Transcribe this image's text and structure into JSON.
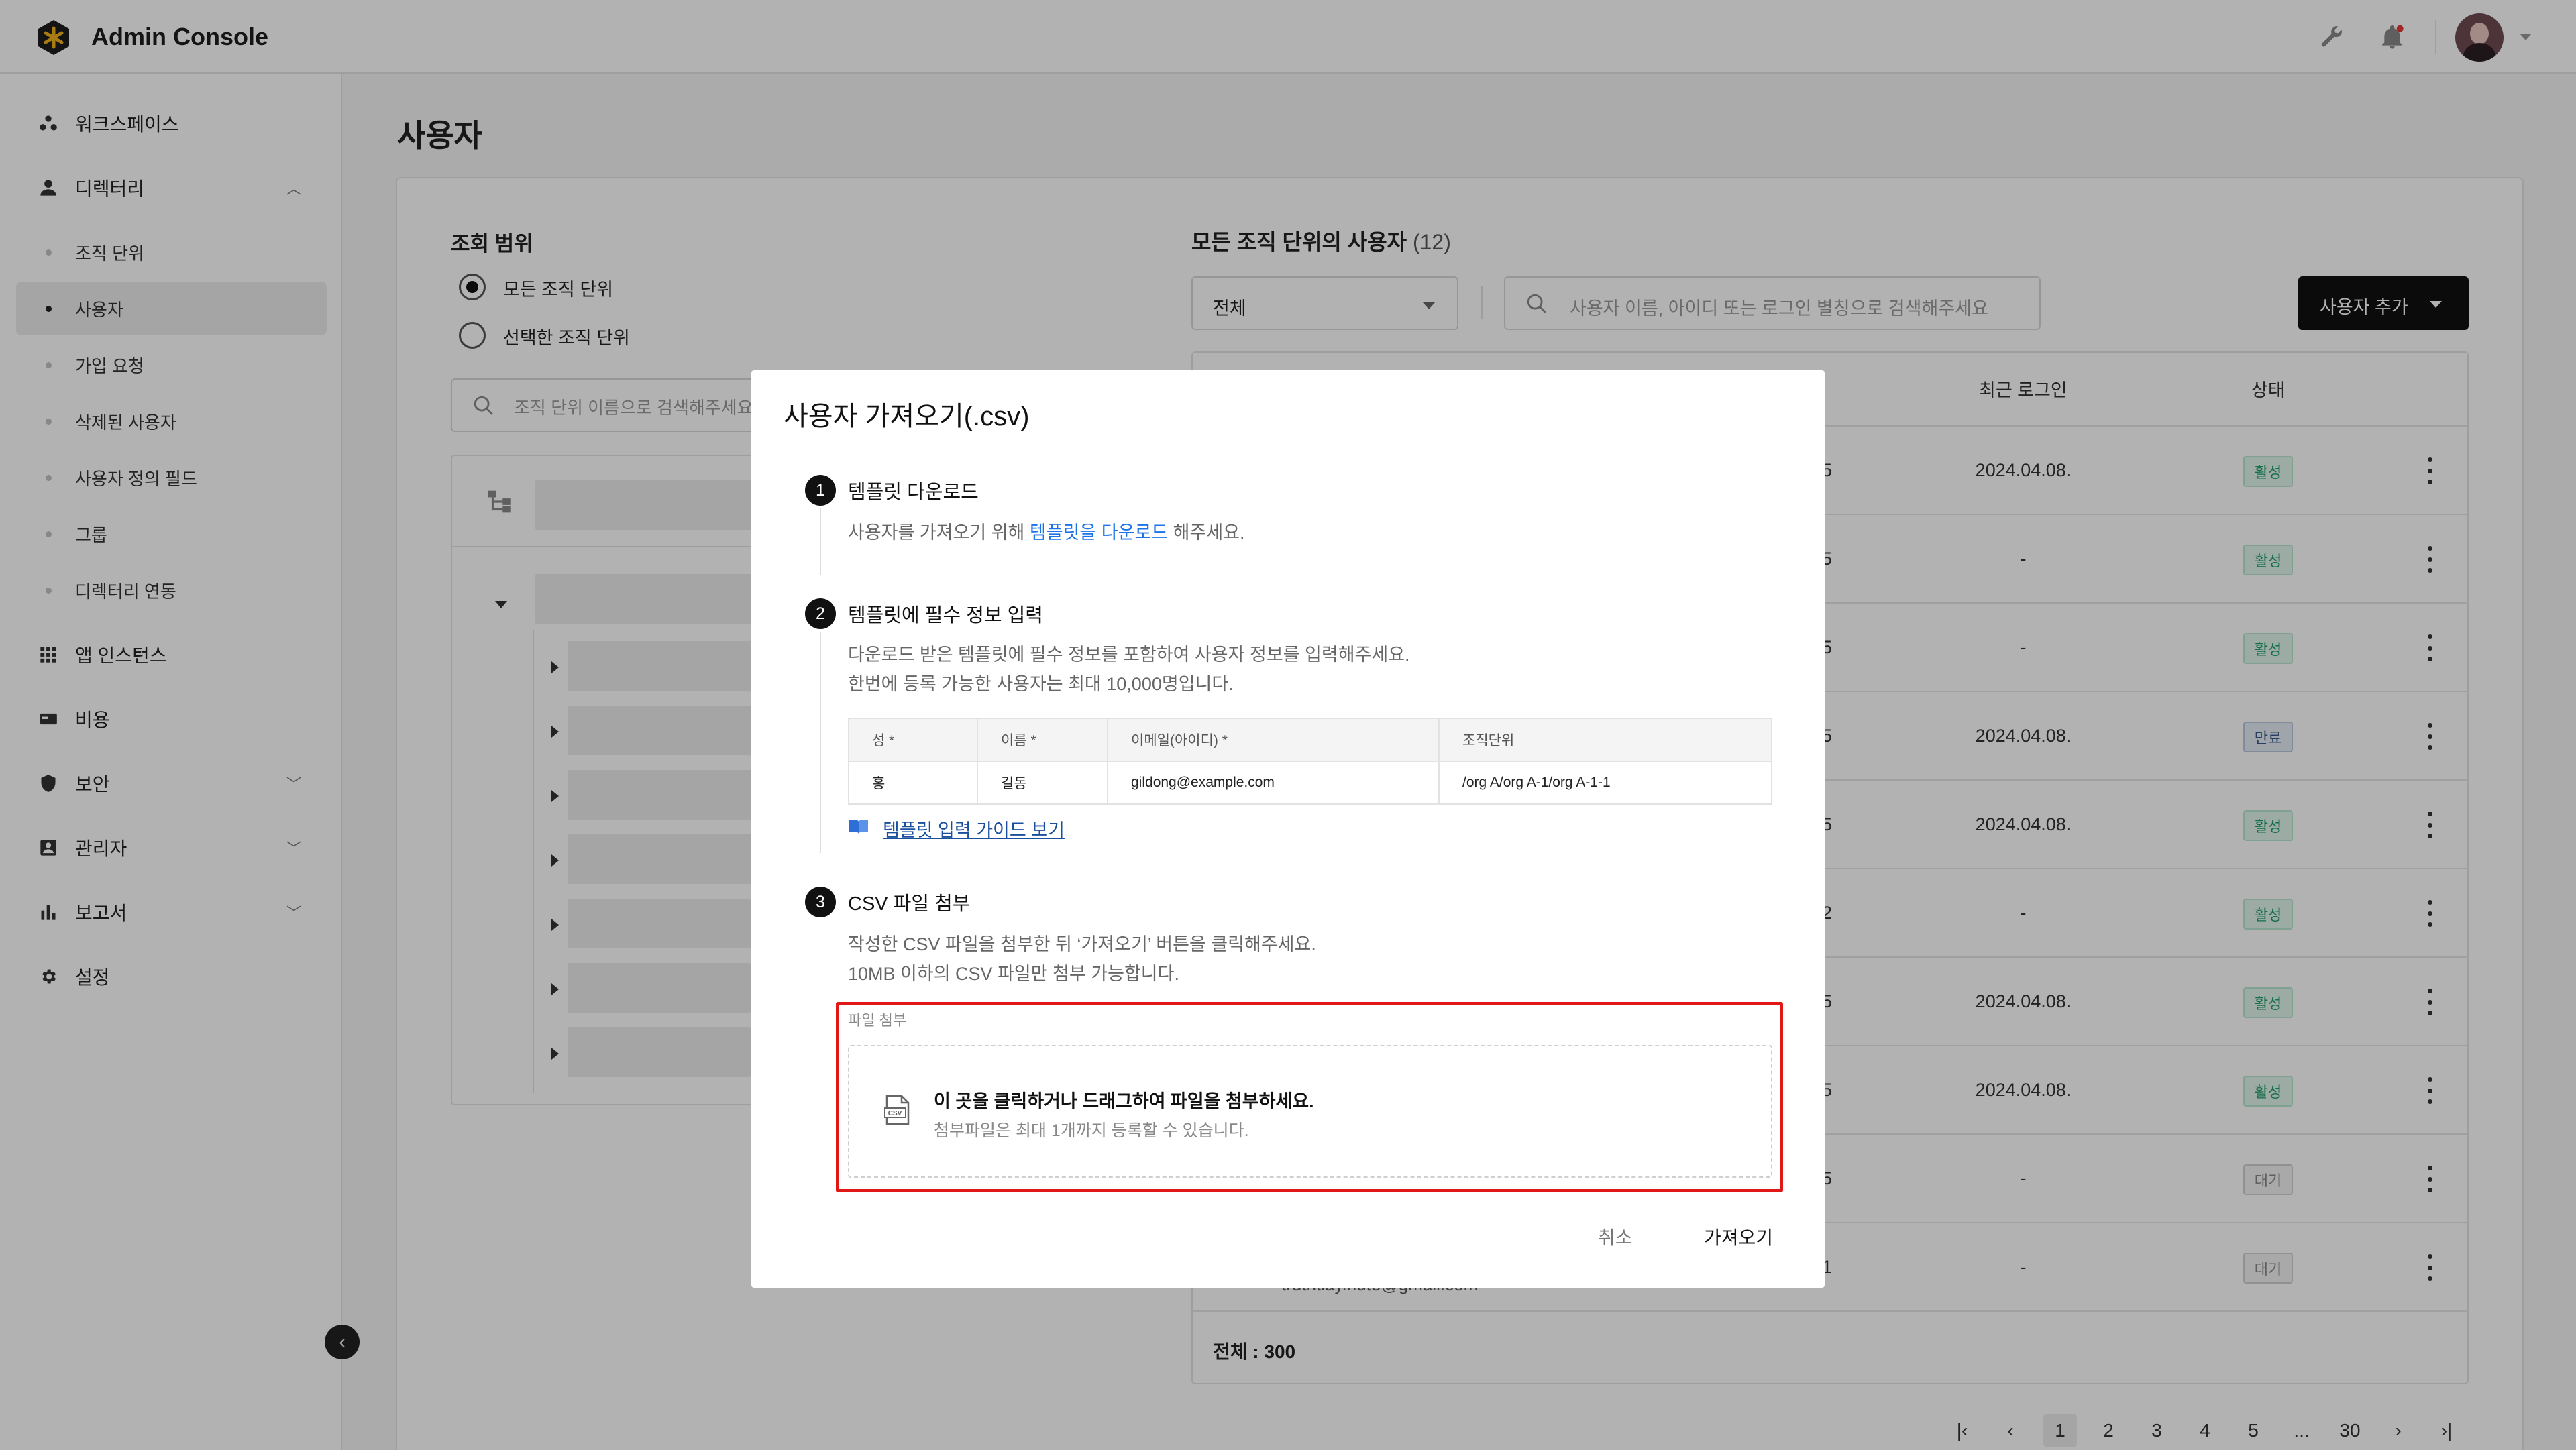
{
  "app": {
    "title": "Admin Console"
  },
  "sidebar": {
    "items": [
      {
        "label": "워크스페이스",
        "icon": "workspace-icon"
      },
      {
        "label": "디렉터리",
        "icon": "person-icon",
        "expanded": true
      },
      {
        "label": "조직 단위",
        "sub": true
      },
      {
        "label": "사용자",
        "sub": true,
        "active": true
      },
      {
        "label": "가입 요청",
        "sub": true
      },
      {
        "label": "삭제된 사용자",
        "sub": true
      },
      {
        "label": "사용자 정의 필드",
        "sub": true
      },
      {
        "label": "그룹",
        "sub": true
      },
      {
        "label": "디렉터리 연동",
        "sub": true
      },
      {
        "label": "앱 인스턴스",
        "icon": "grid-icon"
      },
      {
        "label": "비용",
        "icon": "billing-icon"
      },
      {
        "label": "보안",
        "icon": "shield-icon"
      },
      {
        "label": "관리자",
        "icon": "admin-icon"
      },
      {
        "label": "보고서",
        "icon": "chart-icon"
      },
      {
        "label": "설정",
        "icon": "gear-icon"
      }
    ]
  },
  "page": {
    "title": "사용자"
  },
  "scope": {
    "title": "조회 범위",
    "options": [
      "모든 조직 단위",
      "선택한 조직 단위"
    ],
    "selected": 0,
    "search_placeholder": "조직 단위 이름으로 검색해주세요"
  },
  "users": {
    "title": "모든 조직 단위의 사용자",
    "count": "(12)",
    "filter_value": "전체",
    "search_placeholder": "사용자 이름, 아이디 또는 로그인 별칭으로 검색해주세요",
    "add_button": "사용자 추가",
    "columns": {
      "last_login": "최근 로그인",
      "status": "상태"
    },
    "rows": [
      {
        "frag": "5",
        "last_login": "2024.04.08.",
        "status": "활성",
        "kind": "active"
      },
      {
        "frag": "5",
        "last_login": "-",
        "status": "활성",
        "kind": "active"
      },
      {
        "frag": "5",
        "last_login": "-",
        "status": "활성",
        "kind": "active"
      },
      {
        "frag": "5",
        "last_login": "2024.04.08.",
        "status": "만료",
        "kind": "expired"
      },
      {
        "frag": "5",
        "last_login": "2024.04.08.",
        "status": "활성",
        "kind": "active"
      },
      {
        "frag": "2",
        "last_login": "-",
        "status": "활성",
        "kind": "active"
      },
      {
        "frag": "5",
        "last_login": "2024.04.08.",
        "status": "활성",
        "kind": "active"
      },
      {
        "frag": "5",
        "last_login": "2024.04.08.",
        "status": "활성",
        "kind": "active"
      },
      {
        "frag": "5",
        "last_login": "-",
        "status": "대기",
        "kind": "pending"
      },
      {
        "frag": "1",
        "last_login": "-",
        "status": "대기",
        "kind": "pending"
      }
    ],
    "email_fragment": "truthtiay.hute@gmail.com",
    "total": "전체 : 300"
  },
  "pagination": {
    "pages": [
      "1",
      "2",
      "3",
      "4",
      "5",
      "...",
      "30"
    ],
    "current": "1"
  },
  "modal": {
    "title": "사용자 가져오기(.csv)",
    "step1": {
      "num": "1",
      "title": "템플릿 다운로드",
      "desc_before": "사용자를 가져오기 위해 ",
      "desc_link": "템플릿을 다운로드",
      "desc_after": " 해주세요."
    },
    "step2": {
      "num": "2",
      "title": "템플릿에 필수 정보 입력",
      "desc1": "다운로드 받은 템플릿에 필수 정보를 포함하여 사용자 정보를 입력해주세요.",
      "desc2": "한번에 등록 가능한 사용자는 최대 10,000명입니다.",
      "table_headers": [
        "성 *",
        "이름 *",
        "이메일(아이디) *",
        "조직단위"
      ],
      "table_row": [
        "홍",
        "길동",
        "gildong@example.com",
        "/org A/org A-1/org A-1-1"
      ],
      "guide_link": "템플릿 입력 가이드 보기"
    },
    "step3": {
      "num": "3",
      "title": "CSV 파일 첨부",
      "desc1": "작성한 CSV 파일을 첨부한 뒤 ‘가져오기’ 버튼을 클릭해주세요.",
      "desc2": "10MB 이하의 CSV 파일만 첨부 가능합니다.",
      "attach_label": "파일 첨부",
      "drop_main": "이 곳을 클릭하거나 드래그하여 파일을 첨부하세요.",
      "drop_sub": "첨부파일은 최대 1개까지 등록할 수 있습니다.",
      "csv_icon_text": "CSV"
    },
    "cancel": "취소",
    "import": "가져오기"
  },
  "colors": {
    "highlight": "#e01818",
    "link": "#1a73e8",
    "active_badge": "#1f9c6a"
  }
}
